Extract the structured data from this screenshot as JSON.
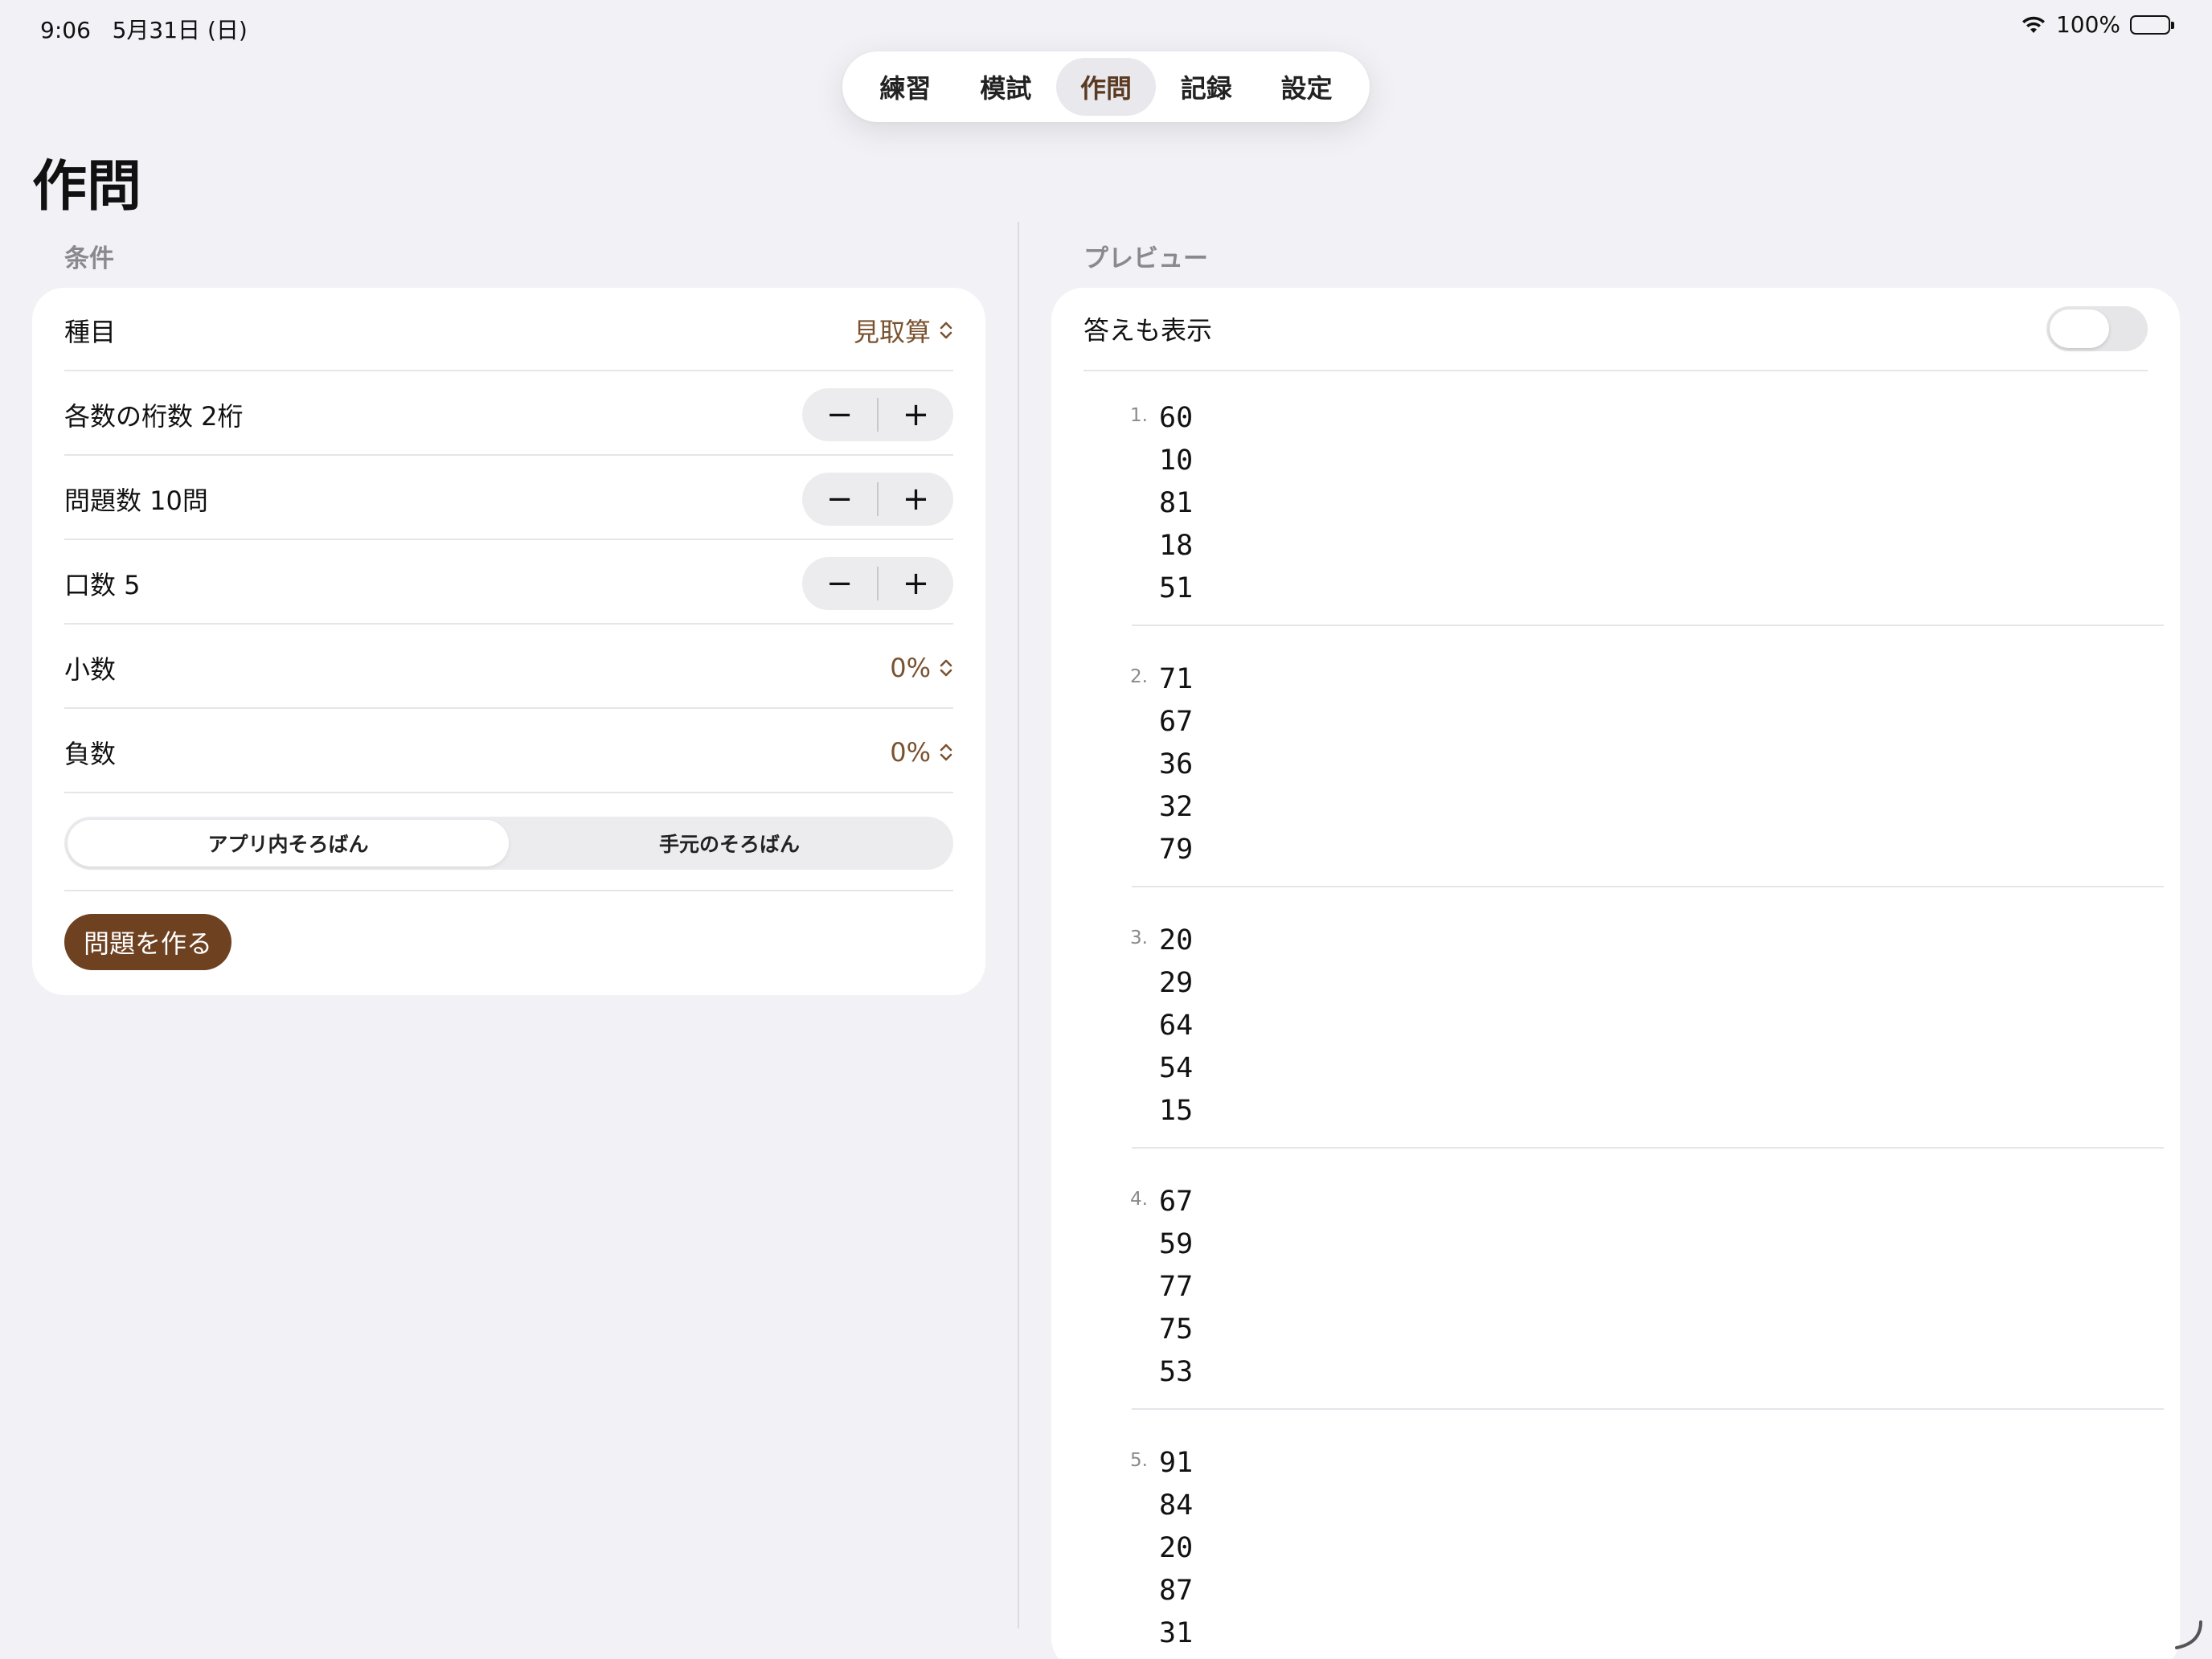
{
  "status": {
    "time": "9:06",
    "date": "5月31日 (日)",
    "battery": "100%"
  },
  "tabs": [
    {
      "label": "練習",
      "active": false
    },
    {
      "label": "模試",
      "active": false
    },
    {
      "label": "作問",
      "active": true
    },
    {
      "label": "記録",
      "active": false
    },
    {
      "label": "設定",
      "active": false
    }
  ],
  "page": {
    "title": "作問"
  },
  "conditions": {
    "header": "条件",
    "category": {
      "label": "種目",
      "value": "見取算"
    },
    "digits": {
      "label": "各数の桁数 2桁"
    },
    "count": {
      "label": "問題数 10問"
    },
    "terms": {
      "label": "口数 5"
    },
    "decimal": {
      "label": "小数",
      "value": "0%"
    },
    "negative": {
      "label": "負数",
      "value": "0%"
    },
    "mode": {
      "options": [
        "アプリ内そろばん",
        "手元のそろばん"
      ],
      "selected": "アプリ内そろばん"
    },
    "make_button": "問題を作る",
    "stepper_minus": "−",
    "stepper_plus": "+"
  },
  "preview": {
    "header": "プレビュー",
    "show_answers_label": "答えも表示",
    "show_answers": false,
    "problems": [
      {
        "num": "1.",
        "values": [
          "60",
          "10",
          "81",
          "18",
          "51"
        ]
      },
      {
        "num": "2.",
        "values": [
          "71",
          "67",
          "36",
          "32",
          "79"
        ]
      },
      {
        "num": "3.",
        "values": [
          "20",
          "29",
          "64",
          "54",
          "15"
        ]
      },
      {
        "num": "4.",
        "values": [
          "67",
          "59",
          "77",
          "75",
          "53"
        ]
      },
      {
        "num": "5.",
        "values": [
          "91",
          "84",
          "20",
          "87",
          "31"
        ]
      }
    ]
  },
  "colors": {
    "accent": "#7a5230",
    "button": "#6e4121",
    "background": "#f2f1f6"
  }
}
